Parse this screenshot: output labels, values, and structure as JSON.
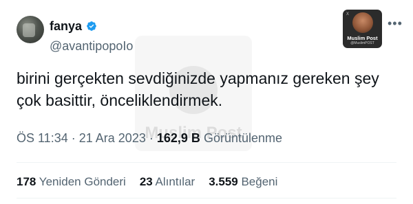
{
  "author": {
    "display_name": "fanya",
    "handle": "@avantipopoIo",
    "verified_color": "#1d9bf0"
  },
  "watermark": {
    "text": "Muslim Post"
  },
  "badge": {
    "title": "Muslim Post",
    "subtitle": "@MuslimPOST",
    "corner_mark": "X"
  },
  "more_icon": "more-horizontal-icon",
  "tweet": {
    "text": "birini gerçekten sevdiğinizde yapmanız gereken şey çok basittir, önceliklendirmek."
  },
  "meta": {
    "time": "ÖS 11:34",
    "separator": "·",
    "date": "21 Ara 2023",
    "views_count": "162,9 B",
    "views_label": "Görüntülenme"
  },
  "stats": [
    {
      "count": "178",
      "label": "Yeniden Gönderi"
    },
    {
      "count": "23",
      "label": "Alıntılar"
    },
    {
      "count": "3.559",
      "label": "Beğeni"
    }
  ]
}
